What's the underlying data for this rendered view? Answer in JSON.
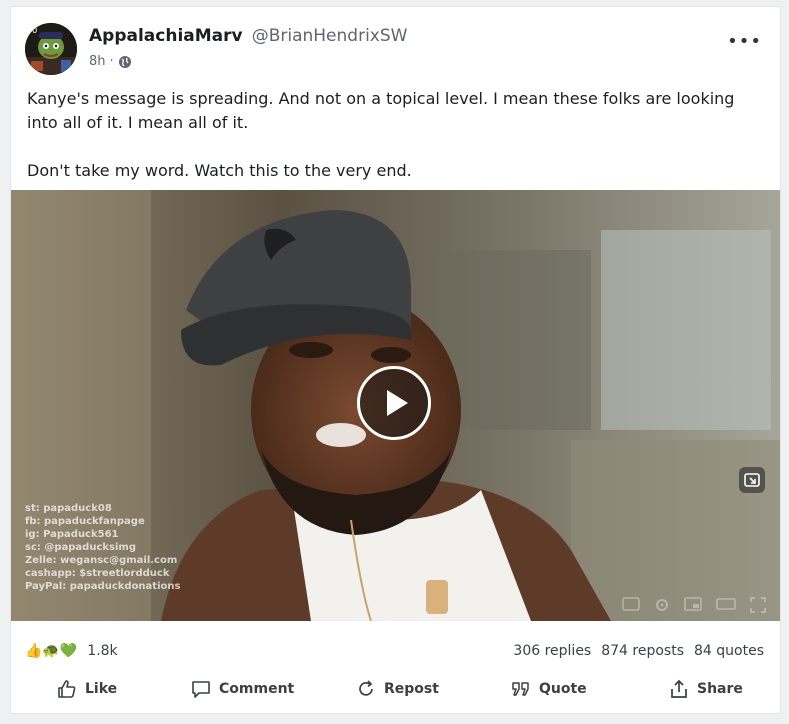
{
  "post": {
    "author": {
      "display_name": "AppalachiaMarv",
      "handle": "@BrianHendrixSW"
    },
    "time": "8h",
    "meta_separator": "·",
    "visibility_icon": "globe-icon",
    "more_label": "•••",
    "text": {
      "paragraph_1": "Kanye's message is spreading. And not on a topical level. I mean these folks are looking into all of it. I mean all of it.",
      "paragraph_2": "Don't take my word. Watch this to the very end."
    },
    "video": {
      "watermark_lines": [
        "st: papaduck08",
        "fb: papaduckfanpage",
        "ig: Papaduck561",
        "sc: @papaducksimg",
        "Zelle: wegansc@gmail.com",
        "cashapp: $streetlordduck",
        "PayPal: papaduckdonations"
      ]
    },
    "stats": {
      "reaction_emojis": "👍🐢💚",
      "reaction_count": "1.8k",
      "replies": "306 replies",
      "reposts": "874 reposts",
      "quotes": "84 quotes"
    },
    "actions": {
      "like": "Like",
      "comment": "Comment",
      "repost": "Repost",
      "quote": "Quote",
      "share": "Share"
    }
  },
  "colors": {
    "text_primary": "#1c1e21",
    "text_secondary": "#5f6670",
    "card_background": "#ffffff",
    "page_background": "#eef0f2"
  }
}
